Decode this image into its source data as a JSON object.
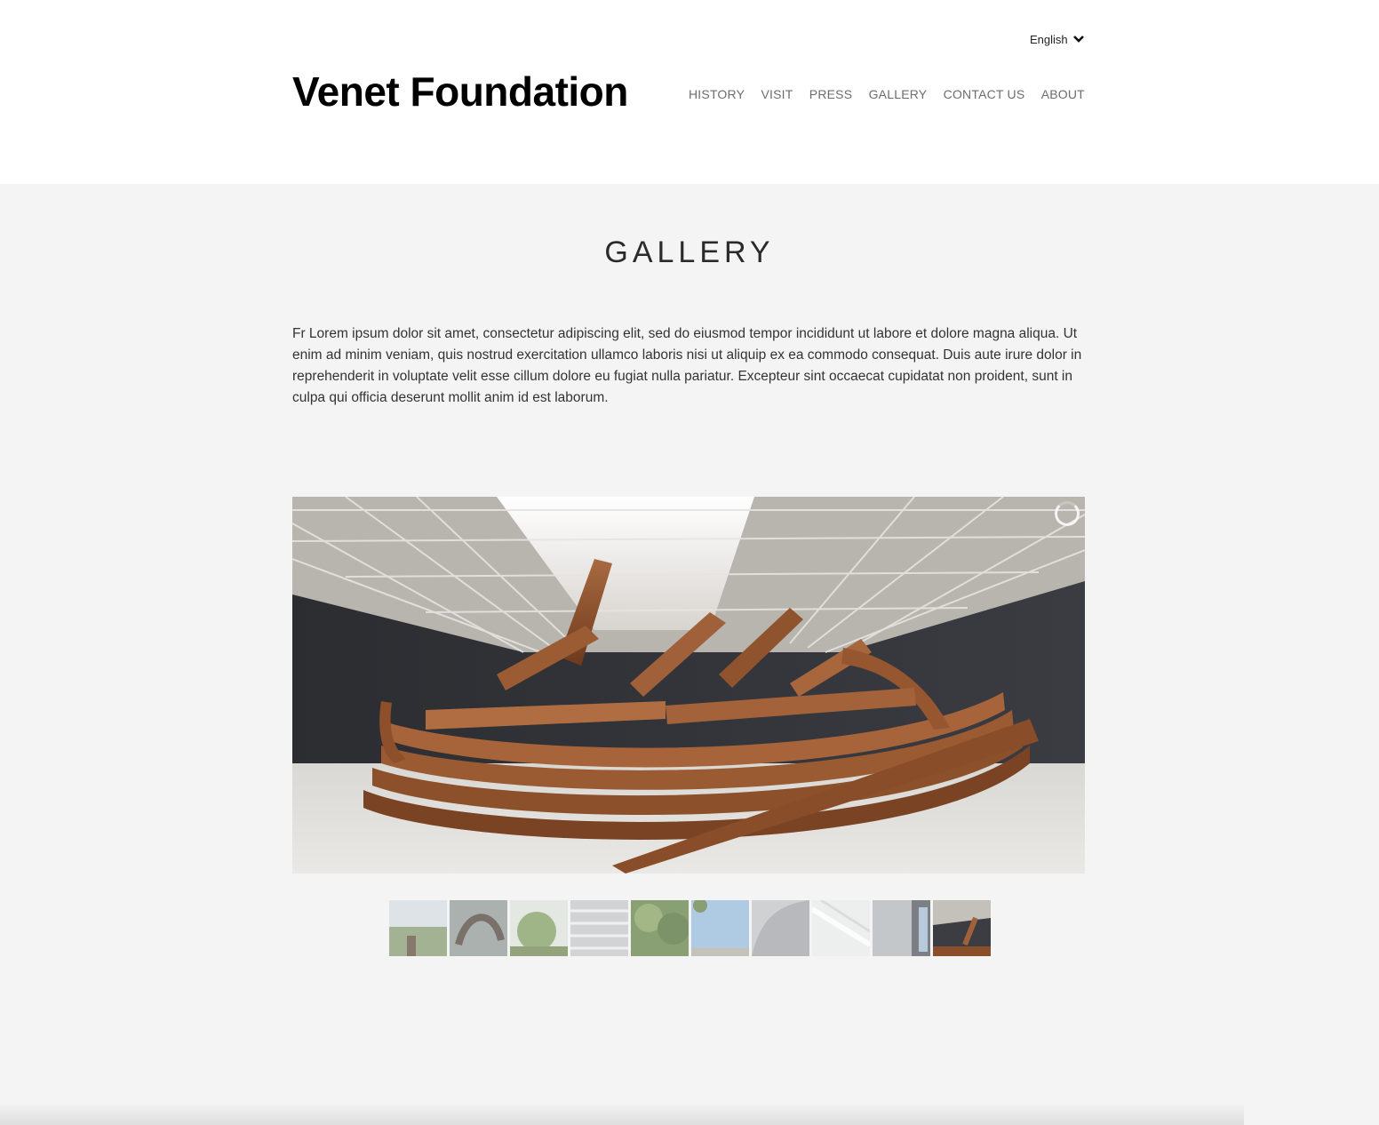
{
  "header": {
    "language": "English",
    "logo": "Venet Foundation",
    "nav": [
      "HISTORY",
      "VISIT",
      "PRESS",
      "GALLERY",
      "CONTACT US",
      "ABOUT"
    ]
  },
  "main": {
    "title": "GALLERY",
    "intro": "Fr Lorem ipsum dolor sit amet, consectetur adipiscing elit, sed do eiusmod tempor incididunt ut labore et dolore magna aliqua. Ut enim ad minim veniam, quis nostrud exercitation ullamco laboris nisi ut aliquip ex ea commodo consequat. Duis aute irure dolor in reprehenderit in voluptate velit esse cillum dolore eu fugiat nulla pariatur. Excepteur sint occaecat cupidatat non proident, sunt in culpa qui officia deserunt mollit anim id est laborum."
  },
  "gallery": {
    "thumbnail_count": 10,
    "active_thumbnail": 10
  },
  "colors": {
    "header_bg": "#ffffff",
    "page_bg": "#f4f4f4",
    "nav_text": "#6d6d6d",
    "steel": "#8a4f2c"
  }
}
